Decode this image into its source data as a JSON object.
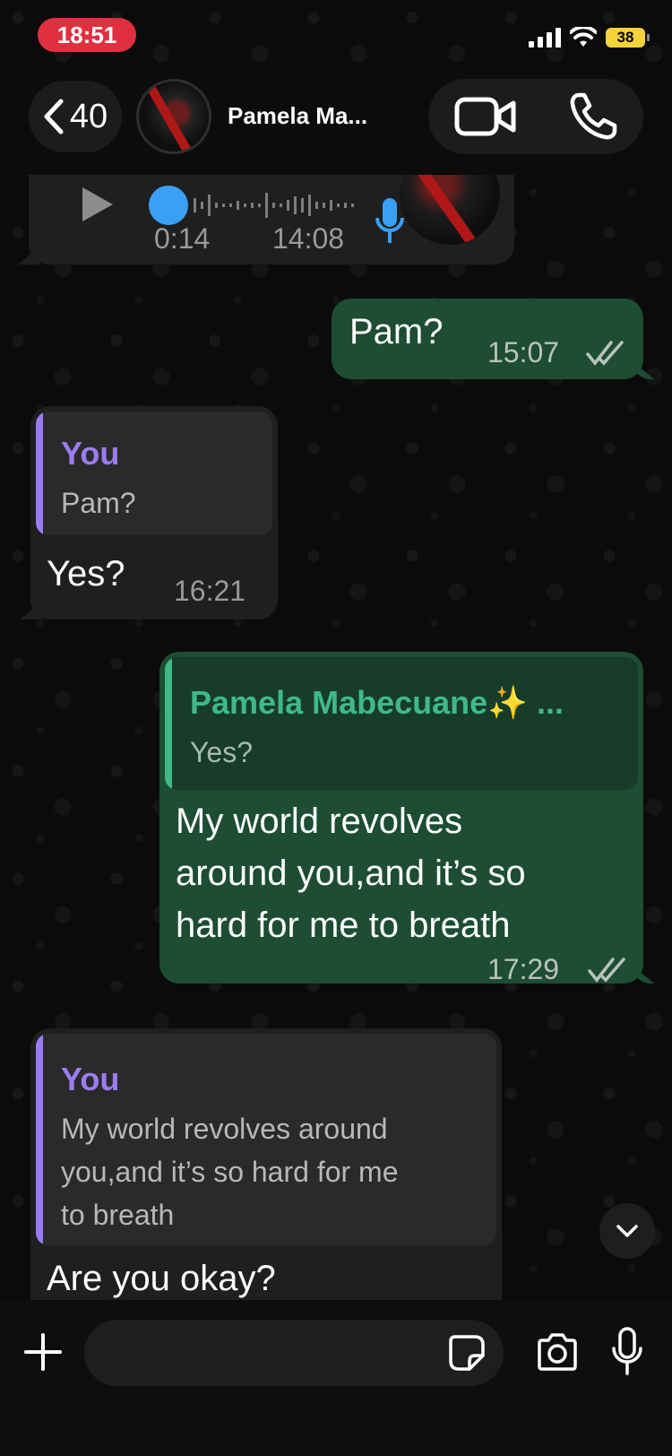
{
  "status_bar": {
    "time": "18:51",
    "battery": "38"
  },
  "header": {
    "back_count": "40",
    "contact_name": "Pamela Ma..."
  },
  "messages": {
    "voice_note": {
      "duration": "0:14",
      "time": "14:08"
    },
    "pam_q": {
      "text": "Pam?",
      "time": "15:07"
    },
    "yes_reply": {
      "quote_author": "You",
      "quote_text": "Pam?",
      "text": "Yes?",
      "time": "16:21"
    },
    "world_msg": {
      "quote_author": "Pamela Mabecuane✨ ...",
      "quote_text": "Yes?",
      "text_line1": "My world revolves",
      "text_line2": "around you,and it’s so",
      "text_line3": "hard for me to breath",
      "time": "17:29"
    },
    "okay_reply": {
      "quote_author": "You",
      "quote_line1": "My world revolves around",
      "quote_line2": "you,and it’s so hard for me",
      "quote_line3": "to breath",
      "text": "Are you okay?"
    }
  },
  "input": {
    "placeholder": ""
  },
  "colors": {
    "incoming_bubble": "#1f1f1f",
    "outgoing_bubble": "#1d4d33",
    "you_author": "#9b7cf2",
    "contact_author": "#3fb98a",
    "time_pill": "#e0303f",
    "battery": "#f3d23a"
  }
}
